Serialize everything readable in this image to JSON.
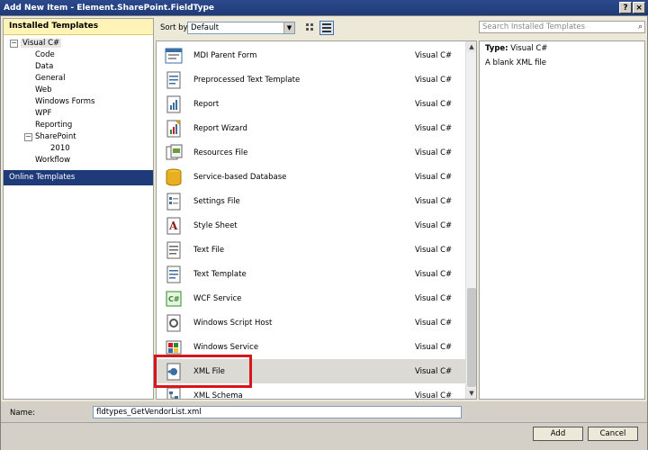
{
  "window": {
    "title": "Add New Item - Element.SharePoint.FieldType",
    "help": "?",
    "close": "×"
  },
  "left_pane": {
    "header": "Installed Templates",
    "tree": [
      {
        "label": "Visual C#",
        "expander": "−",
        "selected": true
      },
      {
        "label": "Code"
      },
      {
        "label": "Data"
      },
      {
        "label": "General"
      },
      {
        "label": "Web"
      },
      {
        "label": "Windows Forms"
      },
      {
        "label": "WPF"
      },
      {
        "label": "Reporting"
      },
      {
        "label": "SharePoint",
        "expander": "−"
      },
      {
        "label": "2010"
      },
      {
        "label": "Workflow"
      }
    ],
    "online": "Online Templates"
  },
  "toolbar": {
    "sort_label": "Sort by:",
    "sort_value": "Default",
    "view_icons": [
      "small-icons-view-icon",
      "list-view-icon"
    ]
  },
  "search": {
    "placeholder": "Search Installed Templates",
    "icon": "search-icon"
  },
  "items": [
    {
      "name": "MDI Parent Form",
      "lang": "Visual C#",
      "icon": "form-icon"
    },
    {
      "name": "Preprocessed Text Template",
      "lang": "Visual C#",
      "icon": "text-template-icon"
    },
    {
      "name": "Report",
      "lang": "Visual C#",
      "icon": "report-icon"
    },
    {
      "name": "Report Wizard",
      "lang": "Visual C#",
      "icon": "report-wizard-icon"
    },
    {
      "name": "Resources File",
      "lang": "Visual C#",
      "icon": "resources-icon"
    },
    {
      "name": "Service-based Database",
      "lang": "Visual C#",
      "icon": "database-icon"
    },
    {
      "name": "Settings File",
      "lang": "Visual C#",
      "icon": "settings-file-icon"
    },
    {
      "name": "Style Sheet",
      "lang": "Visual C#",
      "icon": "style-sheet-icon"
    },
    {
      "name": "Text File",
      "lang": "Visual C#",
      "icon": "text-file-icon"
    },
    {
      "name": "Text Template",
      "lang": "Visual C#",
      "icon": "text-template-icon"
    },
    {
      "name": "WCF Service",
      "lang": "Visual C#",
      "icon": "wcf-service-icon"
    },
    {
      "name": "Windows Script Host",
      "lang": "Visual C#",
      "icon": "script-host-icon"
    },
    {
      "name": "Windows Service",
      "lang": "Visual C#",
      "icon": "windows-service-icon"
    },
    {
      "name": "XML File",
      "lang": "Visual C#",
      "icon": "xml-file-icon",
      "selected": true
    },
    {
      "name": "XML Schema",
      "lang": "Visual C#",
      "icon": "xml-schema-icon"
    }
  ],
  "details": {
    "type_label": "Type:",
    "type_value": "Visual C#",
    "description": "A blank XML file"
  },
  "bottom": {
    "name_label": "Name:",
    "name_value": "fldtypes_GetVendorList.xml",
    "add": "Add",
    "cancel": "Cancel"
  },
  "colors": {
    "title_bar": "#1f3a78",
    "selected_tree": "#e5e5e5",
    "highlight_border": "#d8141c",
    "header_bg": "#fff3b8"
  }
}
